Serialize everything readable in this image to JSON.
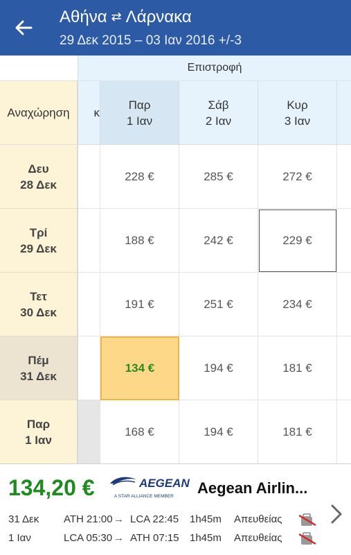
{
  "header": {
    "from": "Αθήνα",
    "swap_glyph": "⇄",
    "to": "Λάρνακα",
    "dates": "29 Δεκ 2015 – 03 Ιαν 2016 +/-3",
    "back_icon": "arrow-left-icon"
  },
  "grid": {
    "return_label": "Επιστροφή",
    "departure_label": "Αναχώρηση",
    "partial_col_label": "κ",
    "columns": [
      {
        "day": "Παρ",
        "date": "1 Ιαν"
      },
      {
        "day": "Σάβ",
        "date": "2 Ιαν"
      },
      {
        "day": "Κυρ",
        "date": "3 Ιαν"
      }
    ],
    "rows": [
      {
        "day": "Δευ",
        "date": "28 Δεκ",
        "prices": [
          "228 €",
          "285 €",
          "272 €"
        ]
      },
      {
        "day": "Τρί",
        "date": "29 Δεκ",
        "prices": [
          "188 €",
          "242 €",
          "229 €"
        ]
      },
      {
        "day": "Τετ",
        "date": "30 Δεκ",
        "prices": [
          "191 €",
          "251 €",
          "234 €"
        ]
      },
      {
        "day": "Πέμ",
        "date": "31 Δεκ",
        "prices": [
          "134 €",
          "194 €",
          "181 €"
        ]
      },
      {
        "day": "Παρ",
        "date": "1 Ιαν",
        "prices": [
          "168 €",
          "194 €",
          "181 €"
        ]
      }
    ]
  },
  "footer": {
    "price": "134,20 €",
    "airline_logo_text": "AEGEAN",
    "airline_logo_tagline": "A STAR ALLIANCE MEMBER",
    "airline": "Aegean Airlin...",
    "legs": [
      {
        "date": "31 Δεκ",
        "dep": "ATH 21:00",
        "arrow": "→",
        "arr": "LCA 22:45",
        "duration": "1h45m",
        "stops": "Απευθείας"
      },
      {
        "date": "1 Ιαν",
        "dep": "LCA 05:30",
        "arrow": "→",
        "arr": "ATH 07:15",
        "duration": "1h45m",
        "stops": "Απευθείας"
      }
    ],
    "no_baggage_icon": "no-baggage-icon",
    "next_icon": "chevron-right-icon"
  },
  "colors": {
    "appbar": "#2d5aa5",
    "best_price_bg": "#fdd889",
    "best_price_text": "#2b8a1e",
    "footer_price": "#1f8a1f",
    "row_header_bg": "#fdf3d6",
    "col_header_bg": "#e6f3fc"
  }
}
